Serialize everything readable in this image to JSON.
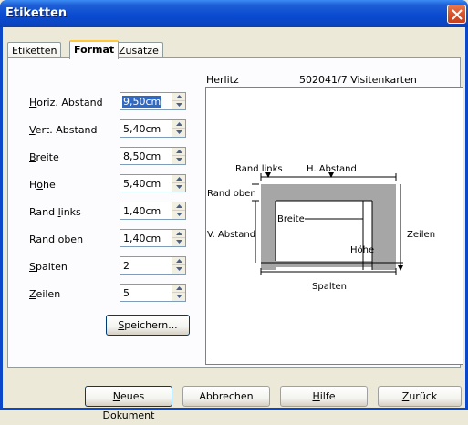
{
  "window": {
    "title": "Etiketten"
  },
  "tabs": [
    {
      "label": "Etiketten"
    },
    {
      "label": "Format"
    },
    {
      "label": "Zusätze"
    }
  ],
  "fields": {
    "horiz_abstand": {
      "pre": "",
      "key": "H",
      "post": "oriz. Abstand",
      "value": "9,50cm"
    },
    "vert_abstand": {
      "pre": "",
      "key": "V",
      "post": "ert. Abstand",
      "value": "5,40cm"
    },
    "breite": {
      "pre": "",
      "key": "B",
      "post": "reite",
      "value": "8,50cm"
    },
    "hoehe": {
      "pre": "H",
      "key": "ö",
      "post": "he",
      "value": "5,40cm"
    },
    "rand_links": {
      "pre": "Rand ",
      "key": "l",
      "post": "inks",
      "value": "1,40cm"
    },
    "rand_oben": {
      "pre": "Rand ",
      "key": "o",
      "post": "ben",
      "value": "1,40cm"
    },
    "spalten": {
      "pre": "",
      "key": "S",
      "post": "palten",
      "value": "2"
    },
    "zeilen": {
      "pre": "",
      "key": "Z",
      "post": "eilen",
      "value": "5"
    }
  },
  "save_button": {
    "key": "S",
    "rest": "peichern..."
  },
  "preview": {
    "brand": "Herlitz",
    "product": "502041/7 Visitenkarten",
    "labels": {
      "rand_links": "Rand links",
      "h_abstand": "H. Abstand",
      "rand_oben": "Rand oben",
      "breite": "Breite",
      "v_abstand": "V. Abstand",
      "zeilen": "Zeilen",
      "hoehe": "Höhe",
      "spalten": "Spalten"
    }
  },
  "footer": {
    "neues_dokument": {
      "key": "N",
      "rest": "eues Dokument"
    },
    "abbrechen": "Abbrechen",
    "hilfe": {
      "key": "H",
      "rest": "ilfe"
    },
    "zurueck": {
      "key": "Z",
      "rest": "urück"
    }
  }
}
